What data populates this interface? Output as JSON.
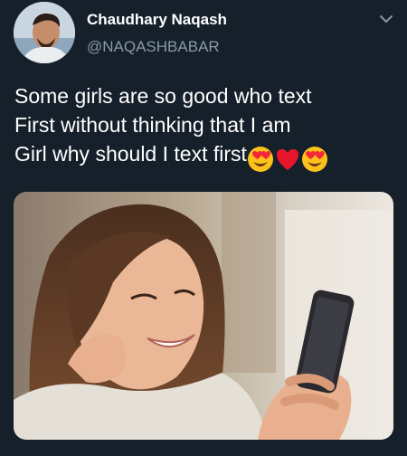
{
  "tweet": {
    "author_name": "Chaudhary Naqash",
    "author_handle": "@NAQASHBABAR",
    "text_line1": "Some girls are so good who text",
    "text_line2": "First without thinking that I am",
    "text_line3": "Girl why should I text first",
    "emojis": [
      "smiling-face-heart-eyes",
      "red-heart",
      "smiling-face-heart-eyes"
    ]
  },
  "colors": {
    "background": "#15202b",
    "text_primary": "#ffffff",
    "text_secondary": "#8899a6"
  },
  "icons": [
    "avatar",
    "chevron-down-icon"
  ]
}
